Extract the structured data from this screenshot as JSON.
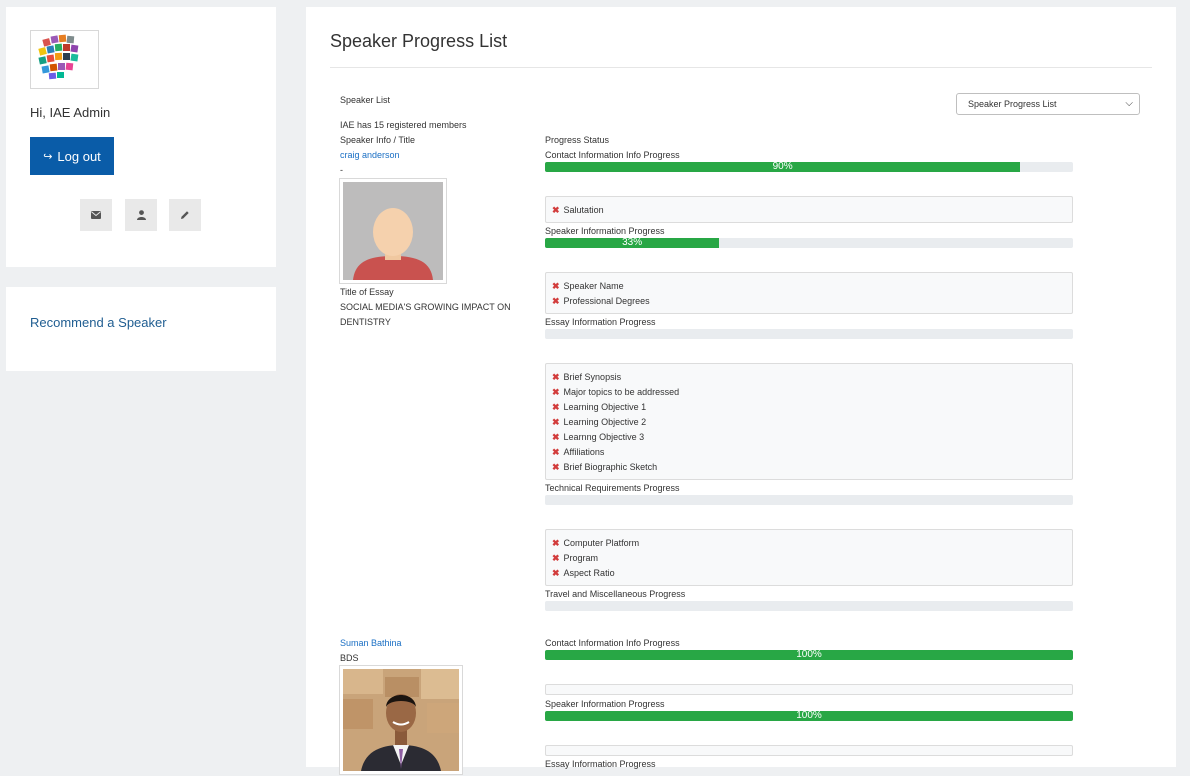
{
  "sidebar": {
    "greeting": "Hi, IAE Admin",
    "logout_label": "Log out",
    "logout_icon": "sign-out-icon",
    "icons": [
      "envelope-icon",
      "user-icon",
      "pencil-icon"
    ],
    "recommend_label": "Recommend a Speaker"
  },
  "main": {
    "title": "Speaker Progress List",
    "speaker_list_label": "Speaker List",
    "members_text": "IAE has 15 registered members",
    "info_header": "Speaker Info / Title",
    "progress_header": "Progress Status",
    "select_value": "Speaker Progress List"
  },
  "speakers": [
    {
      "name": "craig anderson",
      "degree": "-",
      "essay_label": "Title of Essay",
      "essay_title_line1": "SOCIAL MEDIA'S GROWING IMPACT ON",
      "essay_title_line2": "DENTISTRY",
      "sections": [
        {
          "label": "Contact Information Info Progress",
          "value": 90,
          "text": "90%",
          "missing": [
            "Salutation"
          ]
        },
        {
          "label": "Speaker Information Progress",
          "value": 33,
          "text": "33%",
          "missing": [
            "Speaker Name",
            "Professional Degrees"
          ]
        },
        {
          "label": "Essay Information Progress",
          "value": 0,
          "text": "",
          "missing": [
            "Brief Synopsis",
            "Major topics to be addressed",
            "Learning Objective 1",
            "Learning Objective 2",
            "Learnng Objective 3",
            "Affiliations",
            "Brief Biographic Sketch"
          ]
        },
        {
          "label": "Technical Requirements Progress",
          "value": 0,
          "text": "",
          "missing": [
            "Computer Platform",
            "Program",
            "Aspect Ratio"
          ]
        },
        {
          "label": "Travel and Miscellaneous Progress",
          "value": 0,
          "text": "",
          "missing": []
        }
      ]
    },
    {
      "name": "Suman Bathina",
      "degree": "BDS",
      "sections": [
        {
          "label": "Contact Information Info Progress",
          "value": 100,
          "text": "100%",
          "missing": []
        },
        {
          "label": "Speaker Information Progress",
          "value": 100,
          "text": "100%",
          "missing": []
        },
        {
          "label": "Essay Information Progress",
          "value": 0,
          "text": "",
          "missing": []
        }
      ]
    }
  ],
  "colors": {
    "accent": "#0a5ca8",
    "progress": "#28a745",
    "link": "#1a6fc4",
    "error": "#d23c3c"
  }
}
